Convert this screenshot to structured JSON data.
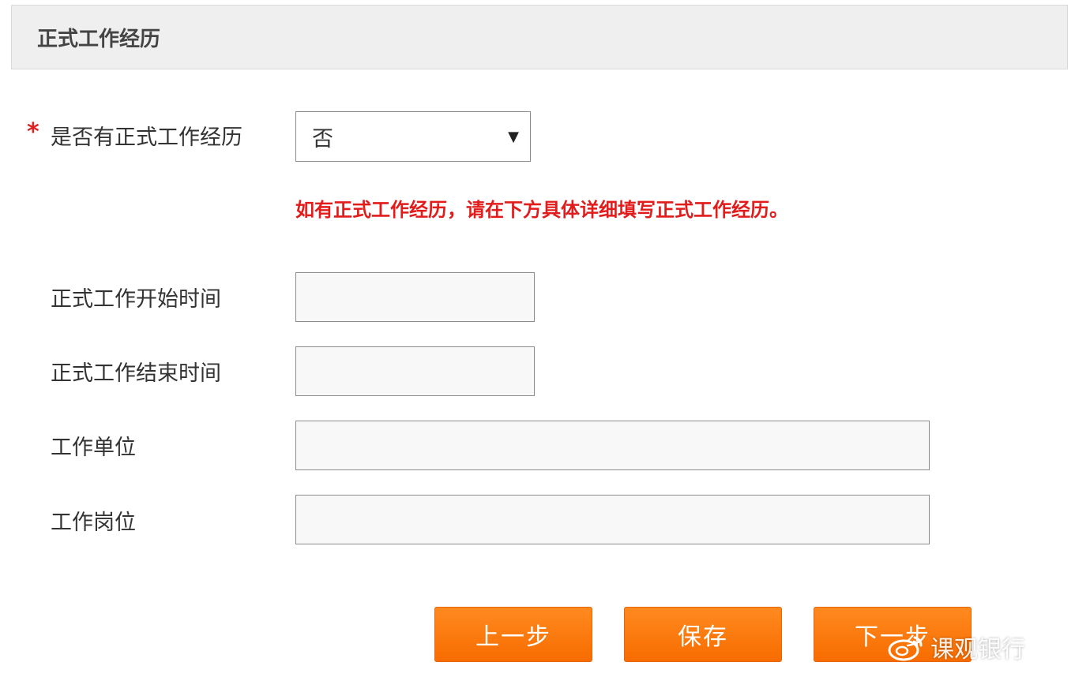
{
  "section": {
    "title": "正式工作经历"
  },
  "form": {
    "required_mark": "*",
    "has_experience": {
      "label": "是否有正式工作经历",
      "selected_value": "否"
    },
    "hint": "如有正式工作经历，请在下方具体详细填写正式工作经历。",
    "start_time": {
      "label": "正式工作开始时间",
      "value": ""
    },
    "end_time": {
      "label": "正式工作结束时间",
      "value": ""
    },
    "employer": {
      "label": "工作单位",
      "value": ""
    },
    "position": {
      "label": "工作岗位",
      "value": ""
    }
  },
  "buttons": {
    "prev_label": "上一步",
    "save_label": "保存",
    "next_label": "下一步"
  },
  "watermark": {
    "text": "课观银行"
  },
  "colors": {
    "accent": "#f76c00",
    "required": "#e02020",
    "hint": "#e21b1b",
    "header_bg": "#efefef"
  }
}
